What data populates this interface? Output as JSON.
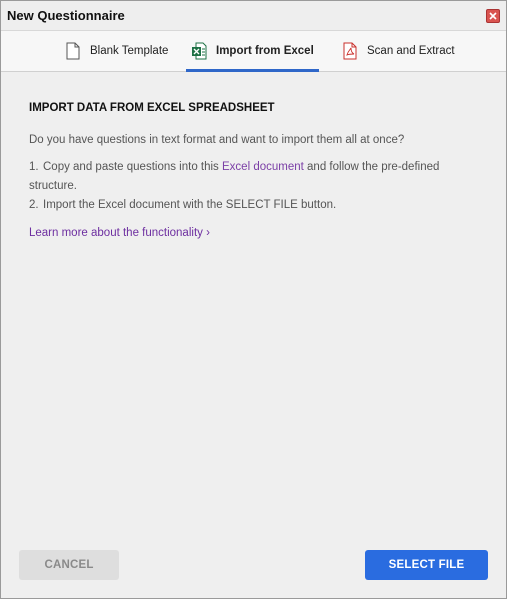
{
  "window": {
    "title": "New Questionnaire",
    "close_icon": "close-icon"
  },
  "tabs": [
    {
      "label": "Blank Template",
      "icon": "document-icon",
      "active": false
    },
    {
      "label": "Import from Excel",
      "icon": "excel-icon",
      "active": true
    },
    {
      "label": "Scan and Extract",
      "icon": "pdf-icon",
      "active": false
    }
  ],
  "content": {
    "heading": "IMPORT DATA FROM EXCEL SPREADSHEET",
    "intro": "Do you have questions in text format and want to import them all at once?",
    "step1": {
      "number": "1.",
      "before": "Copy and paste questions into this ",
      "link": "Excel document",
      "after": " and follow the pre-defined structure."
    },
    "step2": {
      "number": "2.",
      "text": "Import the Excel document with the SELECT FILE button."
    },
    "learn_more": "Learn more about the functionality ›"
  },
  "buttons": {
    "cancel": "CANCEL",
    "select_file": "SELECT FILE"
  },
  "colors": {
    "accent": "#2a6ce0",
    "link": "#7b3fa6",
    "tab_underline": "#2f67c9"
  }
}
